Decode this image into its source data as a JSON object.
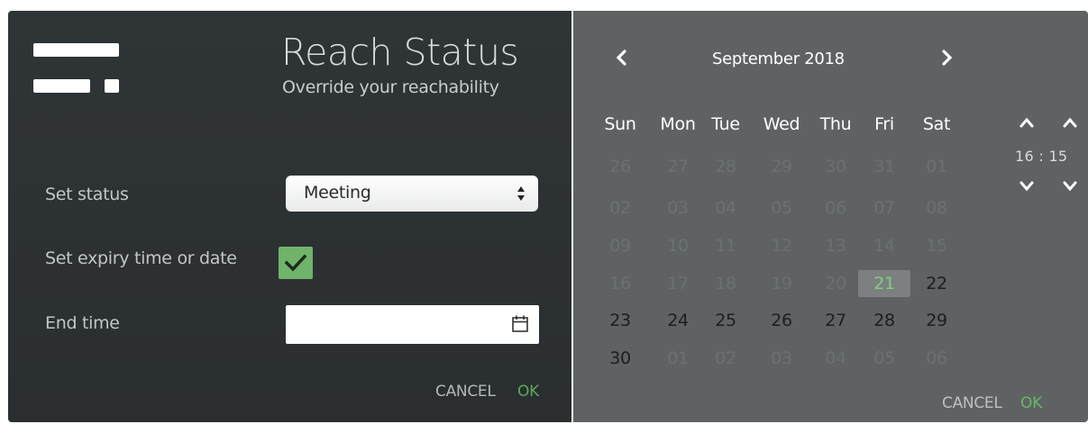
{
  "form": {
    "title": "Reach Status",
    "subtitle": "Override your reachability",
    "status_label": "Set status",
    "status_value": "Meeting",
    "expiry_label": "Set expiry time or date",
    "expiry_checked": true,
    "end_time_label": "End time",
    "end_time_value": "",
    "cancel_label": "CANCEL",
    "ok_label": "OK"
  },
  "calendar": {
    "month_label": "September 2018",
    "weekdays": [
      "Sun",
      "Mon",
      "Tue",
      "Wed",
      "Thu",
      "Fri",
      "Sat"
    ],
    "weeks": [
      [
        {
          "d": "26",
          "s": "dim"
        },
        {
          "d": "27",
          "s": "dim"
        },
        {
          "d": "28",
          "s": "dim"
        },
        {
          "d": "29",
          "s": "dim"
        },
        {
          "d": "30",
          "s": "dim"
        },
        {
          "d": "31",
          "s": "dim"
        },
        {
          "d": "01",
          "s": "dim"
        }
      ],
      [
        {
          "d": "02",
          "s": "dim"
        },
        {
          "d": "03",
          "s": "dim"
        },
        {
          "d": "04",
          "s": "dim"
        },
        {
          "d": "05",
          "s": "dim"
        },
        {
          "d": "06",
          "s": "dim"
        },
        {
          "d": "07",
          "s": "dim"
        },
        {
          "d": "08",
          "s": "dim"
        }
      ],
      [
        {
          "d": "09",
          "s": "dim"
        },
        {
          "d": "10",
          "s": "dim"
        },
        {
          "d": "11",
          "s": "dim"
        },
        {
          "d": "12",
          "s": "dim"
        },
        {
          "d": "13",
          "s": "dim"
        },
        {
          "d": "14",
          "s": "dim"
        },
        {
          "d": "15",
          "s": "dim"
        }
      ],
      [
        {
          "d": "16",
          "s": "dim"
        },
        {
          "d": "17",
          "s": "dim"
        },
        {
          "d": "18",
          "s": "dim"
        },
        {
          "d": "19",
          "s": "dim"
        },
        {
          "d": "20",
          "s": "dim"
        },
        {
          "d": "21",
          "s": "today"
        },
        {
          "d": "22",
          "s": "active"
        }
      ],
      [
        {
          "d": "23",
          "s": "active"
        },
        {
          "d": "24",
          "s": "active"
        },
        {
          "d": "25",
          "s": "active"
        },
        {
          "d": "26",
          "s": "active"
        },
        {
          "d": "27",
          "s": "active"
        },
        {
          "d": "28",
          "s": "active"
        },
        {
          "d": "29",
          "s": "active"
        }
      ],
      [
        {
          "d": "30",
          "s": "active"
        },
        {
          "d": "01",
          "s": "dim"
        },
        {
          "d": "02",
          "s": "dim"
        },
        {
          "d": "03",
          "s": "dim"
        },
        {
          "d": "04",
          "s": "dim"
        },
        {
          "d": "05",
          "s": "dim"
        },
        {
          "d": "06",
          "s": "dim"
        }
      ]
    ],
    "hour": "16",
    "minute": "15",
    "time_separator": ":",
    "cancel_label": "CANCEL",
    "ok_label": "OK"
  },
  "icons": {
    "logo": "reach-logo-icon",
    "select_arrows": "sort-arrows-icon",
    "check": "check-icon",
    "calendar": "calendar-icon",
    "prev": "chevron-left-icon",
    "next": "chevron-right-icon",
    "up": "chevron-up-icon",
    "down": "chevron-down-icon"
  },
  "colors": {
    "left_bg": "#2f3436",
    "right_bg": "#5e6263",
    "accent_green": "#6fb46a",
    "ok_green": "#5ea85a",
    "today_bg": "#7c8080",
    "today_text": "#7fcf79"
  }
}
